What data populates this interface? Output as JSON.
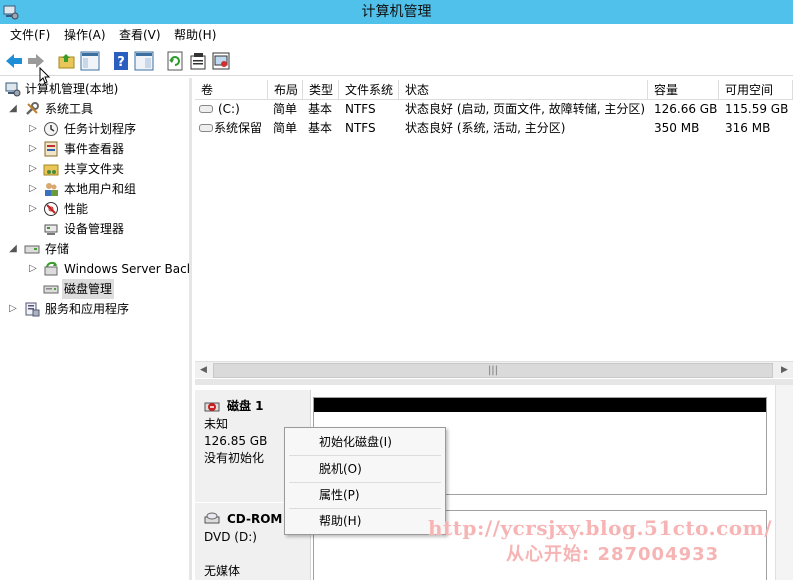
{
  "window": {
    "title": "计算机管理"
  },
  "menu": [
    "文件(F)",
    "操作(A)",
    "查看(V)",
    "帮助(H)"
  ],
  "toolbar": {
    "items": [
      "back-icon",
      "forward-icon",
      "up-folder-icon",
      "show-hide-tree-icon",
      "help-icon",
      "action-pane-icon",
      "refresh-icon",
      "properties-icon",
      "console-icon"
    ]
  },
  "tree": {
    "items": [
      {
        "label": "计算机管理(本地)",
        "icon": "computer-management-icon",
        "expanded": true
      },
      {
        "label": "系统工具",
        "icon": "tools-icon",
        "expanded": true
      },
      {
        "label": "任务计划程序",
        "icon": "clock-icon",
        "expanded": false
      },
      {
        "label": "事件查看器",
        "icon": "event-viewer-icon",
        "expanded": false
      },
      {
        "label": "共享文件夹",
        "icon": "shared-folder-icon",
        "expanded": false
      },
      {
        "label": "本地用户和组",
        "icon": "users-icon",
        "expanded": false
      },
      {
        "label": "性能",
        "icon": "performance-icon",
        "expanded": false
      },
      {
        "label": "设备管理器",
        "icon": "device-manager-icon",
        "expanded": null
      },
      {
        "label": "存储",
        "icon": "storage-icon",
        "expanded": true
      },
      {
        "label": "Windows Server Back",
        "icon": "backup-icon",
        "expanded": false
      },
      {
        "label": "磁盘管理",
        "icon": "disk-management-icon",
        "expanded": null,
        "selected": true
      },
      {
        "label": "服务和应用程序",
        "icon": "services-icon",
        "expanded": false
      }
    ]
  },
  "volume_table": {
    "columns": [
      "卷",
      "布局",
      "类型",
      "文件系统",
      "状态",
      "容量",
      "可用空间"
    ],
    "rows": [
      [
        "(C:)",
        "简单",
        "基本",
        "NTFS",
        "状态良好 (启动, 页面文件, 故障转储, 主分区)",
        "126.66 GB",
        "115.59 GB"
      ],
      [
        "系统保留",
        "简单",
        "基本",
        "NTFS",
        "状态良好 (系统, 活动, 主分区)",
        "350 MB",
        "316 MB"
      ]
    ]
  },
  "disks": [
    {
      "name": "磁盘 1",
      "icon": "disk-error-icon",
      "lines": [
        "未知",
        "126.85 GB",
        "没有初始化"
      ]
    },
    {
      "name": "CD-ROM",
      "icon": "cdrom-icon",
      "lines": [
        "DVD (D:)",
        "",
        "无媒体"
      ]
    }
  ],
  "context_menu": {
    "items": [
      "初始化磁盘(I)",
      "脱机(O)",
      "属性(P)",
      "帮助(H)"
    ]
  },
  "watermark": {
    "line1": "http://ycrsjxy.blog.51cto.com/",
    "line2": "从心开始: 287004933"
  },
  "colors": {
    "titlebar": "#4fc1ea",
    "watermark": "#f7b4b4"
  }
}
